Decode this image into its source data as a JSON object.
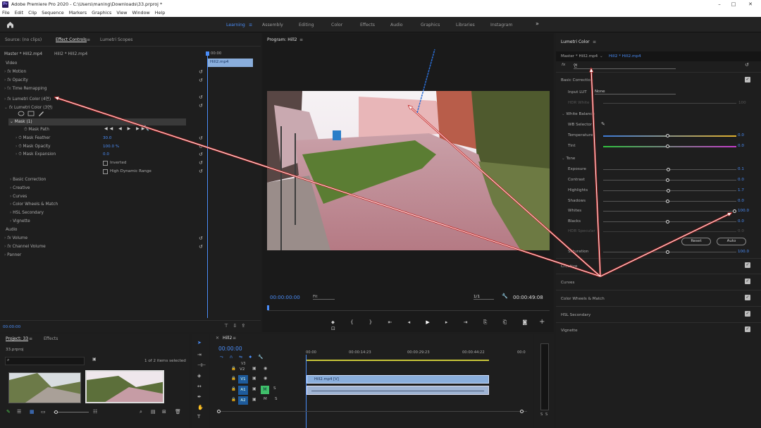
{
  "app": {
    "title": "Adobe Premiere Pro 2020 - C:\\Users\\maning\\Downloads\\33.prproj *",
    "logo": "Pr"
  },
  "menu": [
    "File",
    "Edit",
    "Clip",
    "Sequence",
    "Markers",
    "Graphics",
    "View",
    "Window",
    "Help"
  ],
  "workspaces": {
    "learning": "Learning",
    "items": [
      "Assembly",
      "Editing",
      "Color",
      "Effects",
      "Audio",
      "Graphics",
      "Libraries",
      "Instagram"
    ],
    "more": "»"
  },
  "source_panel": {
    "tabs": [
      "Source: (no clips)",
      "Effect Controls",
      "Lumetri Scopes"
    ],
    "master": "Master * Hill2.mp4",
    "clip": "Hill2 * Hill2.mp4",
    "ruler_time": "00:00",
    "clip_name": "Hill2.mp4",
    "video_label": "Video",
    "audio_label": "Audio",
    "fx_rows": [
      "Motion",
      "Opacity",
      "Time Remapping",
      "Lumetri Color (4연)",
      "Lumetri Color (3연)"
    ],
    "mask": "Mask (1)",
    "mask_path": "Mask Path",
    "mask_feather": "Mask Feather",
    "mask_feather_val": "30.0",
    "mask_opacity": "Mask Opacity",
    "mask_opacity_val": "100.0 %",
    "mask_expansion": "Mask Expansion",
    "mask_expansion_val": "0.0",
    "inverted": "Inverted",
    "hdr_range": "High Dynamic Range",
    "sections": [
      "Basic Correction",
      "Creative",
      "Curves",
      "Color Wheels & Match",
      "HSL Secondary",
      "Vignette"
    ],
    "audio_rows": [
      "Volume",
      "Channel Volume",
      "Panner"
    ],
    "timecode": "00:00:00"
  },
  "program": {
    "title": "Program: Hill2",
    "timecode": "00:00:00:00",
    "fit": "Fit",
    "ratio": "1/1",
    "duration": "00:00:49:08"
  },
  "lumetri": {
    "title": "Lumetri Color",
    "master": "Master * Hill2.mp4",
    "clip": "Hill2 * Hill2.mp4",
    "fx_name": "연",
    "basic": "Basic Correction",
    "input_lut": "Input LUT",
    "lut_val": "None",
    "hdr_white": "HDR White",
    "hdr_white_val": "100",
    "wb": "White Balance",
    "wb_selector": "WB Selector",
    "temperature": "Temperature",
    "temperature_val": "0.0",
    "tint": "Tint",
    "tint_val": "0.0",
    "tone": "Tone",
    "exposure": "Exposure",
    "exposure_val": "0.1",
    "contrast": "Contrast",
    "contrast_val": "0.0",
    "highlights": "Highlights",
    "highlights_val": "1.7",
    "shadows": "Shadows",
    "shadows_val": "0.0",
    "whites": "Whites",
    "whites_val": "100.0",
    "blacks": "Blacks",
    "blacks_val": "0.0",
    "hdr_specular": "HDR Specular",
    "hdr_specular_val": "0.0",
    "saturation": "Saturation",
    "saturation_val": "100.0",
    "reset": "Reset",
    "auto": "Auto",
    "sections": [
      "Creative",
      "Curves",
      "Color Wheels & Match",
      "HSL Secondary",
      "Vignette"
    ]
  },
  "project": {
    "tabs": [
      "Project: 33",
      "Effects"
    ],
    "name": "33.prproj",
    "selected": "1 of 2 items selected"
  },
  "timeline": {
    "title": "Hill2",
    "timecode": "00:00:00",
    "ruler": [
      "00:00",
      "00:00:14:23",
      "00:00:29:23",
      "00:00:44:22",
      "00:0"
    ],
    "tracks": [
      "V2",
      "V1",
      "A1",
      "A2"
    ],
    "v3": "V3",
    "clip_video": "Hill2.mp4 [V]",
    "meter": [
      "S",
      "S"
    ]
  },
  "colors": {
    "accent": "#4a8df8",
    "annotation": "#c62828",
    "clip_video": "#8aaedc",
    "clip_audio": "#9fb4d4"
  },
  "icons": [
    "home-icon",
    "menu-icon",
    "play-icon",
    "step-back-icon",
    "step-forward-icon",
    "camera-icon",
    "wrench-icon",
    "reset-icon",
    "eyedropper-icon",
    "plus-icon",
    "search-icon",
    "eye-icon",
    "lock-icon",
    "arrow-selection-icon",
    "hand-icon",
    "pen-icon",
    "type-icon",
    "razor-icon"
  ]
}
